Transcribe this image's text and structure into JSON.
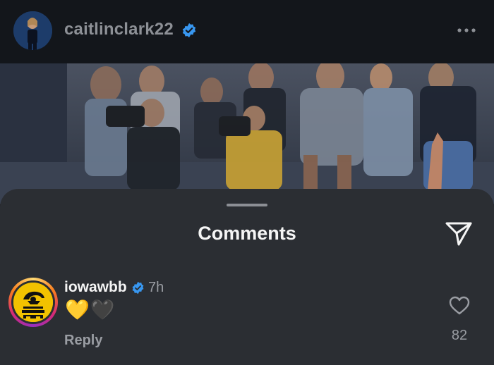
{
  "post": {
    "username": "caitlinclark22",
    "verified": true,
    "more_icon": "more-horizontal-icon"
  },
  "comments_sheet": {
    "title": "Comments",
    "share_icon": "send-icon"
  },
  "comments": [
    {
      "username": "iowawbb",
      "verified": true,
      "time": "7h",
      "text": "💛🖤",
      "reply_label": "Reply",
      "like_count": "82",
      "avatar_ring": true
    }
  ],
  "colors": {
    "accent_verified": "#3897f0",
    "background": "#0f1115",
    "sheet": "#2b2e33",
    "secondary_text": "#9a9da3"
  }
}
